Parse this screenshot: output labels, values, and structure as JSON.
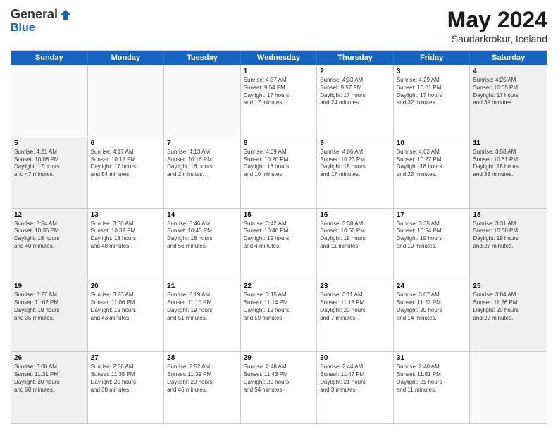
{
  "logo": {
    "general": "General",
    "blue": "Blue"
  },
  "title": "May 2024",
  "subtitle": "Saudarkrokur, Iceland",
  "header_days": [
    "Sunday",
    "Monday",
    "Tuesday",
    "Wednesday",
    "Thursday",
    "Friday",
    "Saturday"
  ],
  "weeks": [
    [
      {
        "day": "",
        "text": "",
        "empty": true
      },
      {
        "day": "",
        "text": "",
        "empty": true
      },
      {
        "day": "",
        "text": "",
        "empty": true
      },
      {
        "day": "1",
        "text": "Sunrise: 4:37 AM\nSunset: 9:54 PM\nDaylight: 17 hours\nand 17 minutes.",
        "empty": false
      },
      {
        "day": "2",
        "text": "Sunrise: 4:33 AM\nSunset: 9:57 PM\nDaylight: 17 hours\nand 24 minutes.",
        "empty": false
      },
      {
        "day": "3",
        "text": "Sunrise: 4:29 AM\nSunset: 10:01 PM\nDaylight: 17 hours\nand 32 minutes.",
        "empty": false
      },
      {
        "day": "4",
        "text": "Sunrise: 4:25 AM\nSunset: 10:05 PM\nDaylight: 17 hours\nand 39 minutes.",
        "empty": false
      }
    ],
    [
      {
        "day": "5",
        "text": "Sunrise: 4:21 AM\nSunset: 10:08 PM\nDaylight: 17 hours\nand 47 minutes.",
        "empty": false
      },
      {
        "day": "6",
        "text": "Sunrise: 4:17 AM\nSunset: 10:12 PM\nDaylight: 17 hours\nand 54 minutes.",
        "empty": false
      },
      {
        "day": "7",
        "text": "Sunrise: 4:13 AM\nSunset: 10:16 PM\nDaylight: 18 hours\nand 2 minutes.",
        "empty": false
      },
      {
        "day": "8",
        "text": "Sunrise: 4:09 AM\nSunset: 10:20 PM\nDaylight: 18 hours\nand 10 minutes.",
        "empty": false
      },
      {
        "day": "9",
        "text": "Sunrise: 4:06 AM\nSunset: 10:23 PM\nDaylight: 18 hours\nand 17 minutes.",
        "empty": false
      },
      {
        "day": "10",
        "text": "Sunrise: 4:02 AM\nSunset: 10:27 PM\nDaylight: 18 hours\nand 25 minutes.",
        "empty": false
      },
      {
        "day": "11",
        "text": "Sunrise: 3:58 AM\nSunset: 10:31 PM\nDaylight: 18 hours\nand 33 minutes.",
        "empty": false
      }
    ],
    [
      {
        "day": "12",
        "text": "Sunrise: 3:54 AM\nSunset: 10:35 PM\nDaylight: 18 hours\nand 40 minutes.",
        "empty": false
      },
      {
        "day": "13",
        "text": "Sunrise: 3:50 AM\nSunset: 10:39 PM\nDaylight: 18 hours\nand 48 minutes.",
        "empty": false
      },
      {
        "day": "14",
        "text": "Sunrise: 3:46 AM\nSunset: 10:43 PM\nDaylight: 18 hours\nand 56 minutes.",
        "empty": false
      },
      {
        "day": "15",
        "text": "Sunrise: 3:42 AM\nSunset: 10:46 PM\nDaylight: 19 hours\nand 4 minutes.",
        "empty": false
      },
      {
        "day": "16",
        "text": "Sunrise: 3:38 AM\nSunset: 10:50 PM\nDaylight: 19 hours\nand 11 minutes.",
        "empty": false
      },
      {
        "day": "17",
        "text": "Sunrise: 3:35 AM\nSunset: 10:54 PM\nDaylight: 19 hours\nand 19 minutes.",
        "empty": false
      },
      {
        "day": "18",
        "text": "Sunrise: 3:31 AM\nSunset: 10:58 PM\nDaylight: 19 hours\nand 27 minutes.",
        "empty": false
      }
    ],
    [
      {
        "day": "19",
        "text": "Sunrise: 3:27 AM\nSunset: 11:02 PM\nDaylight: 19 hours\nand 35 minutes.",
        "empty": false
      },
      {
        "day": "20",
        "text": "Sunrise: 3:23 AM\nSunset: 11:06 PM\nDaylight: 19 hours\nand 43 minutes.",
        "empty": false
      },
      {
        "day": "21",
        "text": "Sunrise: 3:19 AM\nSunset: 11:10 PM\nDaylight: 19 hours\nand 51 minutes.",
        "empty": false
      },
      {
        "day": "22",
        "text": "Sunrise: 3:15 AM\nSunset: 11:14 PM\nDaylight: 19 hours\nand 59 minutes.",
        "empty": false
      },
      {
        "day": "23",
        "text": "Sunrise: 3:11 AM\nSunset: 11:18 PM\nDaylight: 20 hours\nand 7 minutes.",
        "empty": false
      },
      {
        "day": "24",
        "text": "Sunrise: 3:07 AM\nSunset: 11:22 PM\nDaylight: 20 hours\nand 14 minutes.",
        "empty": false
      },
      {
        "day": "25",
        "text": "Sunrise: 3:04 AM\nSunset: 11:26 PM\nDaylight: 20 hours\nand 22 minutes.",
        "empty": false
      }
    ],
    [
      {
        "day": "26",
        "text": "Sunrise: 3:00 AM\nSunset: 11:31 PM\nDaylight: 20 hours\nand 30 minutes.",
        "empty": false
      },
      {
        "day": "27",
        "text": "Sunrise: 2:56 AM\nSunset: 11:35 PM\nDaylight: 20 hours\nand 38 minutes.",
        "empty": false
      },
      {
        "day": "28",
        "text": "Sunrise: 2:52 AM\nSunset: 11:39 PM\nDaylight: 20 hours\nand 46 minutes.",
        "empty": false
      },
      {
        "day": "29",
        "text": "Sunrise: 2:48 AM\nSunset: 11:43 PM\nDaylight: 20 hours\nand 54 minutes.",
        "empty": false
      },
      {
        "day": "30",
        "text": "Sunrise: 2:44 AM\nSunset: 11:47 PM\nDaylight: 21 hours\nand 3 minutes.",
        "empty": false
      },
      {
        "day": "31",
        "text": "Sunrise: 2:40 AM\nSunset: 11:51 PM\nDaylight: 21 hours\nand 11 minutes.",
        "empty": false
      },
      {
        "day": "",
        "text": "",
        "empty": true
      }
    ]
  ]
}
